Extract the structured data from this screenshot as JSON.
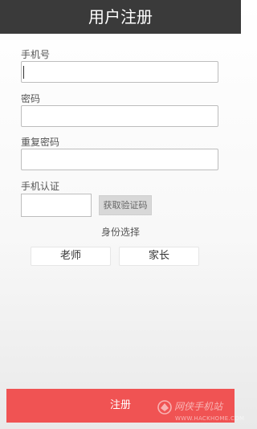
{
  "header": {
    "title": "用户注册"
  },
  "form": {
    "phone_label": "手机号",
    "phone_value": "",
    "password_label": "密码",
    "password_value": "",
    "confirm_label": "重复密码",
    "confirm_value": "",
    "verify_label": "手机认证",
    "code_value": "",
    "get_code_button": "获取验证码"
  },
  "role": {
    "heading": "身份选择",
    "options": [
      "老师",
      "家长"
    ]
  },
  "submit": {
    "label": "注册"
  },
  "watermark": {
    "name": "网侠手机站",
    "url": "WWW.HACKHOME.COM"
  },
  "colors": {
    "title_bar": "#3a3a3a",
    "submit_button": "#f05353",
    "code_button": "#d8d8d8"
  }
}
